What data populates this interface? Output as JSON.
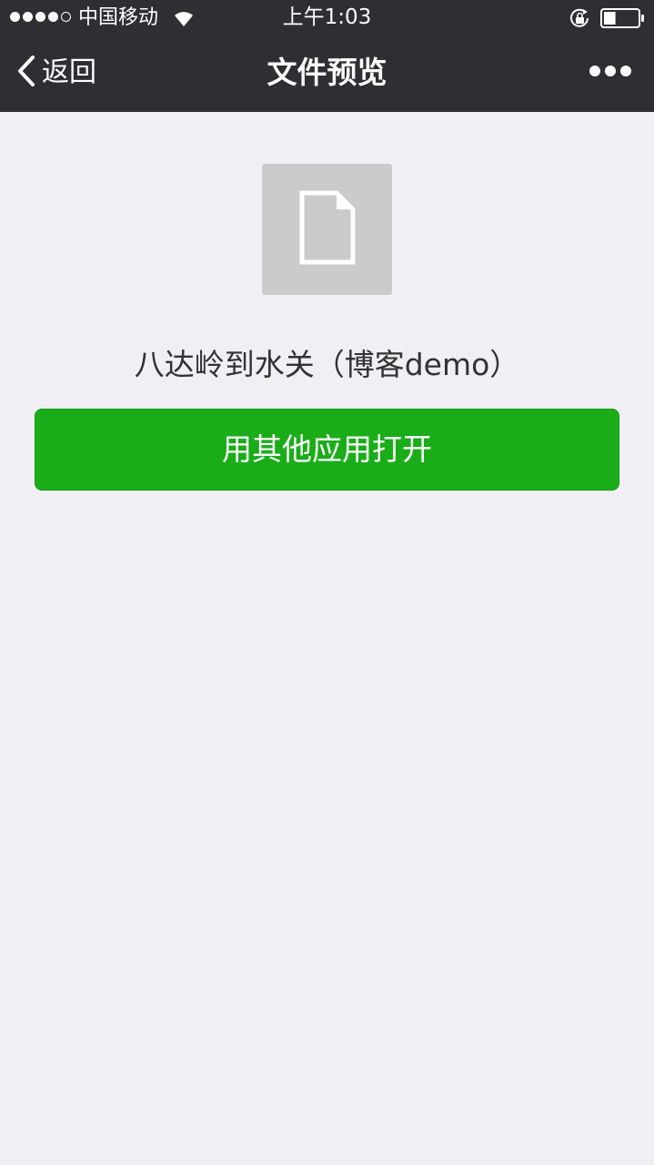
{
  "status_bar": {
    "carrier": "中国移动",
    "time": "上午1:03",
    "signal_strength": 4,
    "signal_max": 5,
    "battery_level": 0.35,
    "icons": [
      "signal-icon",
      "wifi-icon",
      "rotation-lock-icon",
      "battery-icon"
    ]
  },
  "nav": {
    "back_label": "返回",
    "title": "文件预览",
    "icons": [
      "chevron-left-icon",
      "more-icon"
    ]
  },
  "file": {
    "name": "八达岭到水关（博客demo）",
    "icon": "file-icon"
  },
  "actions": {
    "open_with_label": "用其他应用打开"
  },
  "colors": {
    "nav_background": "#2f2e33",
    "page_background": "#efeff4",
    "primary_button": "#1aad19",
    "thumbnail_background": "#cbcbcb"
  }
}
